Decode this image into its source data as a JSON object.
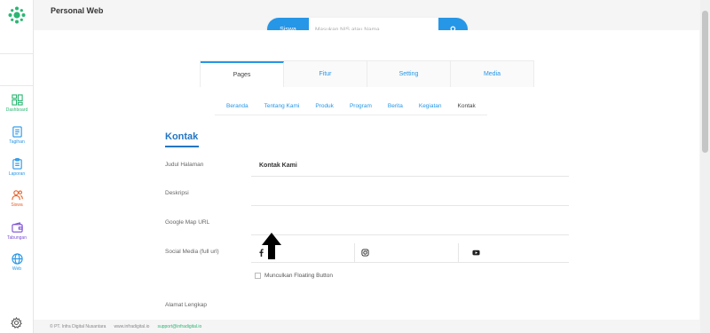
{
  "header": {
    "app_title": "Personal Web",
    "search": {
      "category": "Siswa",
      "placeholder": "Masukan NIS atau Nama"
    }
  },
  "sidebar": {
    "items": [
      {
        "label": "Dashboard",
        "icon": "dashboard-icon",
        "color": "#2bb673"
      },
      {
        "label": "Tagihan",
        "icon": "invoice-icon",
        "color": "#2696e7"
      },
      {
        "label": "Laporan",
        "icon": "report-icon",
        "color": "#2696e7"
      },
      {
        "label": "Siswa",
        "icon": "students-icon",
        "color": "#e8632a"
      },
      {
        "label": "Tabungan",
        "icon": "wallet-icon",
        "color": "#7b4fd4"
      },
      {
        "label": "Web",
        "icon": "globe-icon",
        "color": "#2696e7"
      }
    ]
  },
  "tabs": [
    {
      "label": "Pages",
      "active": true
    },
    {
      "label": "Fitur",
      "active": false
    },
    {
      "label": "Setting",
      "active": false
    },
    {
      "label": "Media",
      "active": false
    }
  ],
  "subnav": [
    {
      "label": "Beranda",
      "active": false
    },
    {
      "label": "Tentang Kami",
      "active": false
    },
    {
      "label": "Produk",
      "active": false
    },
    {
      "label": "Program",
      "active": false
    },
    {
      "label": "Berita",
      "active": false
    },
    {
      "label": "Kegiatan",
      "active": false
    },
    {
      "label": "Kontak",
      "active": true
    }
  ],
  "form": {
    "section_title": "Kontak",
    "judul_label": "Judul Halaman",
    "judul_value": "Kontak Kami",
    "deskripsi_label": "Deskripsi",
    "map_label": "Google Map URL",
    "social_label": "Social Media (full url)",
    "floating_label": "Munculkan Floating Button",
    "floating_checked": false,
    "alamat_label": "Alamat Lengkap"
  },
  "footer": {
    "copyright": "© PT. Infra Digital Nusantara",
    "website": "www.infradigital.io",
    "email": "support@infradigital.io"
  },
  "colors": {
    "accent": "#2696e7",
    "brand": "#2bb673",
    "title": "#2376c4"
  }
}
